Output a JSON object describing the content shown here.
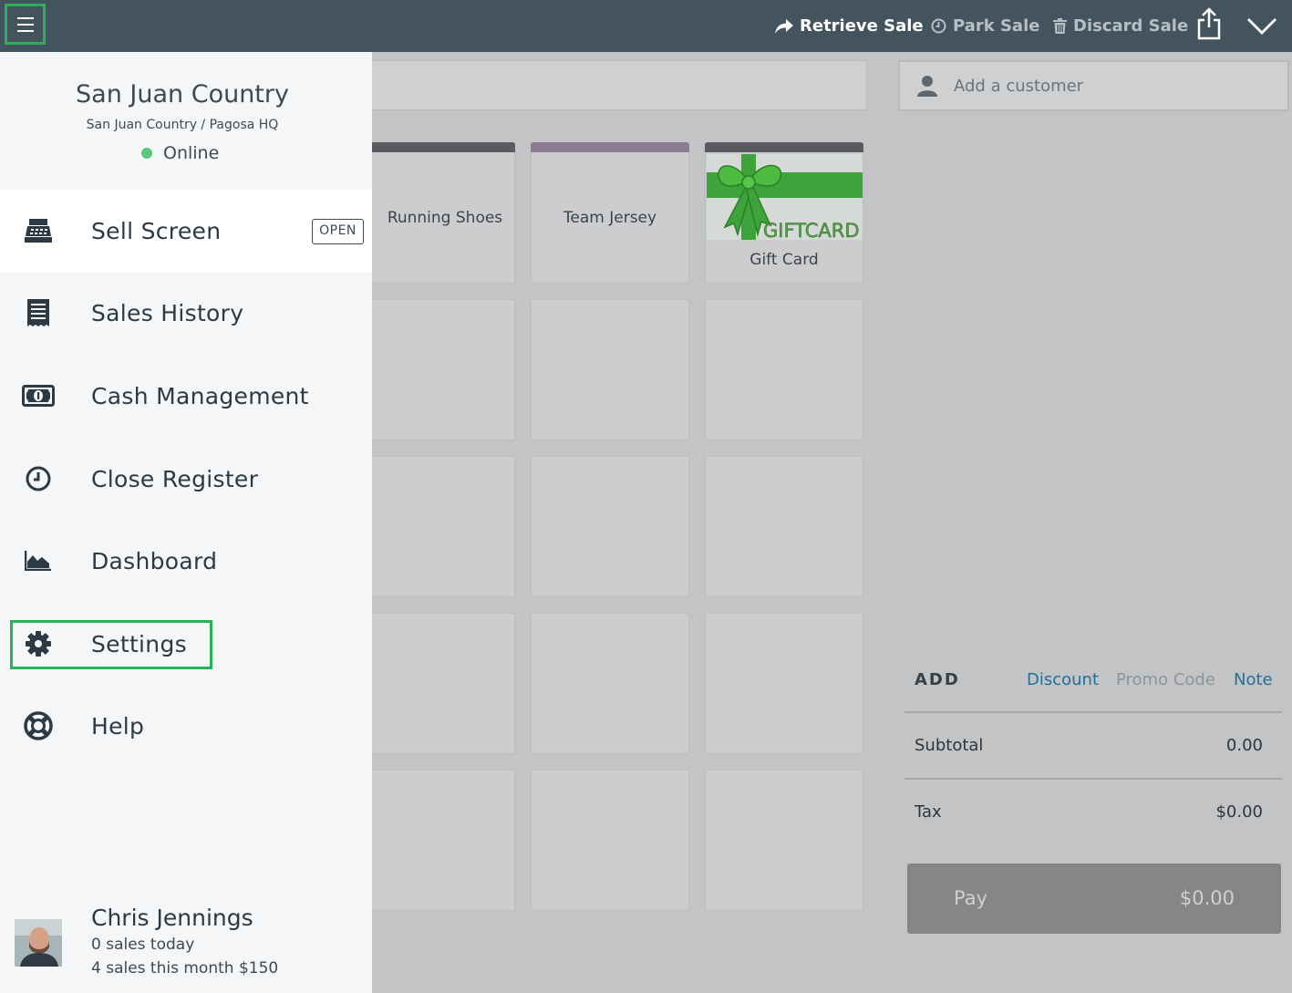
{
  "topbar": {
    "retrieve_sale": "Retrieve Sale",
    "park_sale": "Park Sale",
    "discard_sale": "Discard Sale"
  },
  "sidebar": {
    "store_name": "San Juan Country",
    "store_location": "San Juan Country / Pagosa HQ",
    "status": "Online",
    "items": [
      {
        "label": "Sell Screen",
        "icon": "register-icon",
        "badge": "OPEN"
      },
      {
        "label": "Sales History",
        "icon": "receipt-icon"
      },
      {
        "label": "Cash Management",
        "icon": "cash-icon"
      },
      {
        "label": "Close Register",
        "icon": "clock-icon"
      },
      {
        "label": "Dashboard",
        "icon": "chart-area-icon"
      },
      {
        "label": "Settings",
        "icon": "gear-icon"
      },
      {
        "label": "Help",
        "icon": "lifebuoy-icon"
      }
    ],
    "user": {
      "name": "Chris Jennings",
      "sales_today": "0 sales today",
      "sales_month": "4 sales this month $150"
    }
  },
  "products": {
    "tiles": [
      {
        "label": "Running Shoes"
      },
      {
        "label": "Team Jersey"
      },
      {
        "label": "Gift Card",
        "image_text": "GIFTCARD"
      }
    ]
  },
  "sale": {
    "customer_placeholder": "Add a customer",
    "add_label": "ADD",
    "discount": "Discount",
    "promo_code": "Promo Code",
    "note": "Note",
    "subtotal_label": "Subtotal",
    "subtotal_value": "0.00",
    "tax_label": "Tax",
    "tax_value": "$0.00",
    "pay_label": "Pay",
    "pay_amount": "$0.00"
  },
  "colors": {
    "topbar": "#44545e",
    "highlight": "#29b05a",
    "link": "#1f6f9a",
    "online": "#5cc67a"
  }
}
